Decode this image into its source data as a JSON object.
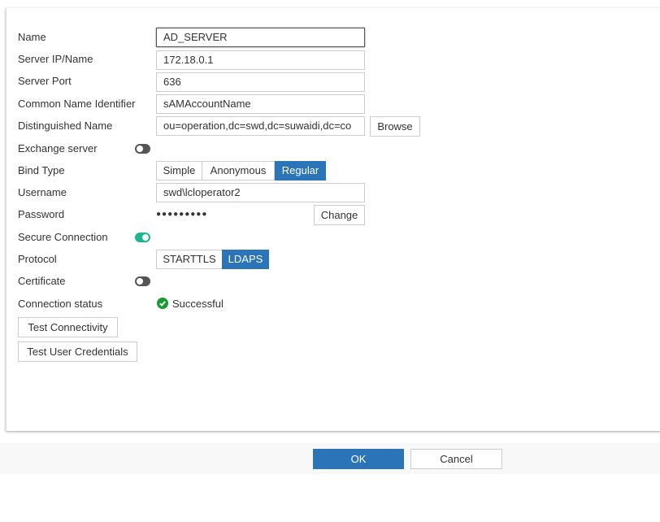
{
  "form": {
    "name": {
      "label": "Name",
      "value": "AD_SERVER"
    },
    "server_ip": {
      "label": "Server IP/Name",
      "value": "172.18.0.1"
    },
    "server_port": {
      "label": "Server Port",
      "value": "636"
    },
    "cn_identifier": {
      "label": "Common Name Identifier",
      "value": "sAMAccountName"
    },
    "distinguished_name": {
      "label": "Distinguished Name",
      "value": "ou=operation,dc=swd,dc=suwaidi,dc=co",
      "browse": "Browse"
    },
    "exchange_server": {
      "label": "Exchange server",
      "enabled": false
    },
    "bind_type": {
      "label": "Bind Type",
      "options": [
        "Simple",
        "Anonymous",
        "Regular"
      ],
      "selected": "Regular"
    },
    "username": {
      "label": "Username",
      "value": "swd\\lcloperator2"
    },
    "password": {
      "label": "Password",
      "value": "●●●●●●●●●",
      "change": "Change"
    },
    "secure_connection": {
      "label": "Secure Connection",
      "enabled": true
    },
    "protocol": {
      "label": "Protocol",
      "options": [
        "STARTTLS",
        "LDAPS"
      ],
      "selected": "LDAPS"
    },
    "certificate": {
      "label": "Certificate",
      "enabled": false
    },
    "connection_status": {
      "label": "Connection status",
      "value": "Successful",
      "color": "#1a9a2e"
    },
    "test_connectivity": "Test Connectivity",
    "test_user_credentials": "Test User Credentials"
  },
  "footer": {
    "ok": "OK",
    "cancel": "Cancel"
  },
  "colors": {
    "accent": "#2b74b8",
    "toggle_on": "#1fb58f"
  }
}
